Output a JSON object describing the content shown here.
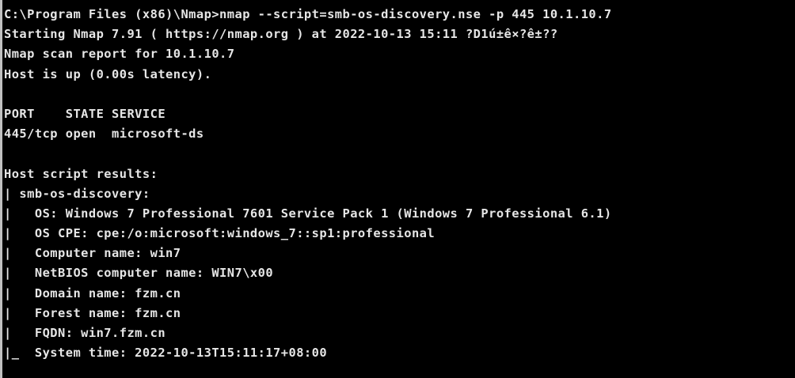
{
  "terminal": {
    "colors": {
      "background": "#000000",
      "foreground": "#e6e6e6"
    },
    "lines": [
      "C:\\Program Files (x86)\\Nmap>nmap --script=smb-os-discovery.nse -p 445 10.1.10.7",
      "Starting Nmap 7.91 ( https://nmap.org ) at 2022-10-13 15:11 ?D1ú±ê×?ê±??",
      "Nmap scan report for 10.1.10.7",
      "Host is up (0.00s latency).",
      "",
      "PORT    STATE SERVICE",
      "445/tcp open  microsoft-ds",
      "",
      "Host script results:",
      "| smb-os-discovery:",
      "|   OS: Windows 7 Professional 7601 Service Pack 1 (Windows 7 Professional 6.1)",
      "|   OS CPE: cpe:/o:microsoft:windows_7::sp1:professional",
      "|   Computer name: win7",
      "|   NetBIOS computer name: WIN7\\x00",
      "|   Domain name: fzm.cn",
      "|   Forest name: fzm.cn",
      "|   FQDN: win7.fzm.cn",
      "|_  System time: 2022-10-13T15:11:17+08:00"
    ]
  }
}
